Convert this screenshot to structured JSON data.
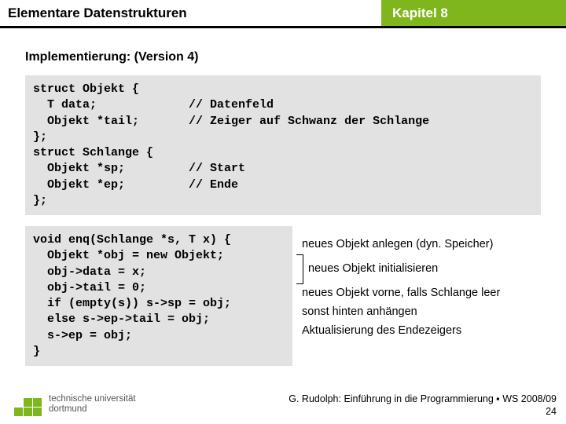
{
  "header": {
    "left": "Elementare Datenstrukturen",
    "right": "Kapitel 8"
  },
  "subtitle": "Implementierung: (Version 4)",
  "code1": "struct Objekt {\n  T data;             // Datenfeld\n  Objekt *tail;       // Zeiger auf Schwanz der Schlange\n};\nstruct Schlange {\n  Objekt *sp;         // Start\n  Objekt *ep;         // Ende\n};",
  "code2": "void enq(Schlange *s, T x) {\n  Objekt *obj = new Objekt;\n  obj->data = x;\n  obj->tail = 0;\n  if (empty(s)) s->sp = obj;\n  else s->ep->tail = obj;\n  s->ep = obj;\n}",
  "notes": {
    "n1": "neues Objekt anlegen (dyn. Speicher)",
    "n2": "neues Objekt initialisieren",
    "n3": "neues Objekt vorne, falls Schlange leer",
    "n4": "sonst hinten anhängen",
    "n5": "Aktualisierung des Endezeigers"
  },
  "footer": {
    "line": "G. Rudolph: Einführung in die Programmierung ▪ WS 2008/09",
    "page": "24"
  },
  "logo": {
    "uni1": "technische universität",
    "uni2": "dortmund"
  }
}
